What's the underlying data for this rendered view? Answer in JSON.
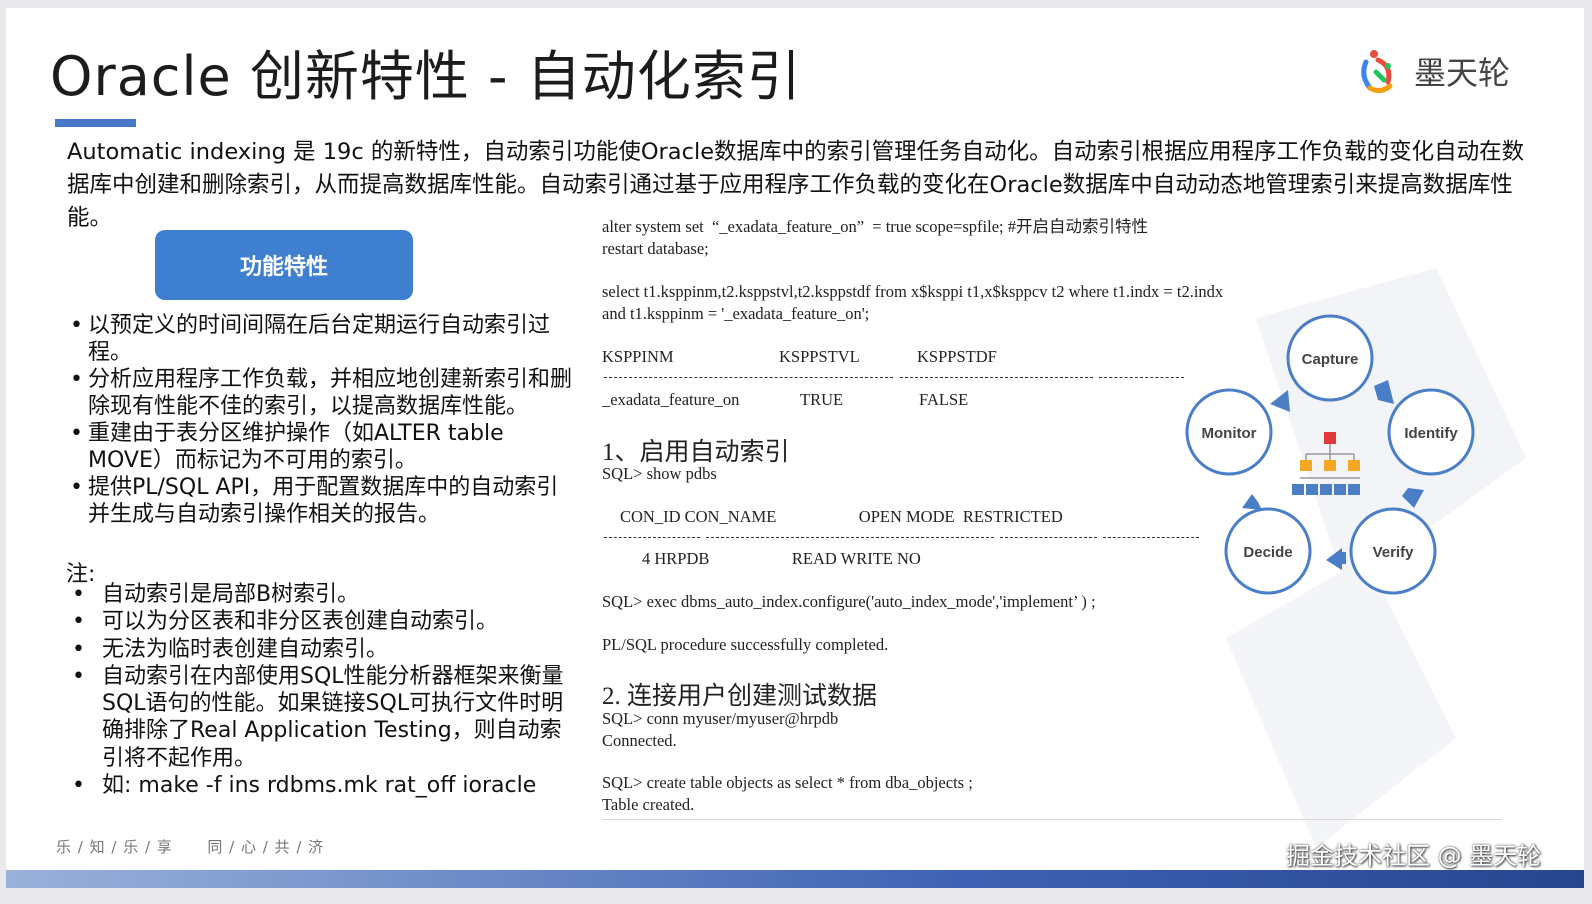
{
  "title": "Oracle 创新特性 - 自动化索引",
  "logo": {
    "text": "墨天轮",
    "colors": [
      "#e94b3c",
      "#3b82f6",
      "#22c55e",
      "#f59e0b"
    ]
  },
  "intro_text": "Automatic indexing 是 19c 的新特性，自动索引功能使Oracle数据库中的索引管理任务自动化。自动索引根据应用程序工作负载的变化自动在数据库中创建和删除索引，从而提高数据库性能。自动索引通过基于应用程序工作负载的变化在Oracle数据库中自动动态地管理索引来提高数据库性能。",
  "feature_label": "功能特性",
  "features": [
    "以预定义的时间间隔在后台定期运行自动索引过程。",
    "分析应用程序工作负载，并相应地创建新索引和删除现有性能不佳的索引，以提高数据库性能。",
    "重建由于表分区维护操作（如ALTER table MOVE）而标记为不可用的索引。",
    "提供PL/SQL API，用于配置数据库中的自动索引并生成与自动索引操作相关的报告。"
  ],
  "note_title": "注:",
  "notes": [
    "自动索引是局部B树索引。",
    "可以为分区表和非分区表创建自动索引。",
    "无法为临时表创建自动索引。",
    "自动索引在内部使用SQL性能分析器框架来衡量SQL语句的性能。如果链接SQL可执行文件时明确排除了Real Application Testing，则自动索引将不起作用。",
    "如: make -f ins rdbms.mk rat_off ioracle"
  ],
  "code": {
    "alter_line": "alter system set  “_exadata_feature_on”  = true scope=spfile; #开启自动索引特性",
    "restart_line": "restart database;",
    "select_line1": "select t1.ksppinm,t2.ksppstvl,t2.ksppstdf from x$ksppi t1,x$ksppcv t2 where t1.indx = t2.indx",
    "select_line2": "and t1.ksppinm = '_exadata_feature_on';",
    "col1": "KSPPINM",
    "col2": "KSPPSTVL",
    "col3": "KSPPSTDF",
    "val1": "_exadata_feature_on",
    "val2": "TRUE",
    "val3": "FALSE",
    "heading1": "1、启用自动索引",
    "show_pdbs": "SQL> show pdbs",
    "pdb_header": "CON_ID CON_NAME                    OPEN MODE  RESTRICTED",
    "pdb_row": "4 HRPDB                    READ WRITE NO",
    "exec_line": "SQL> exec dbms_auto_index.configure('auto_index_mode','implement’ ) ;",
    "plsql_line": "PL/SQL procedure successfully completed.",
    "heading2": "2. 连接用户创建测试数据",
    "conn_line": "SQL> conn myuser/myuser@hrpdb",
    "connected_line": "Connected.",
    "create_line": "SQL> create table objects as select * from dba_objects ;",
    "created_line": "Table created."
  },
  "cycle": {
    "capture": "Capture",
    "identify": "Identify",
    "verify": "Verify",
    "decide": "Decide",
    "monitor": "Monitor"
  },
  "footer_left": "乐 / 知 / 乐 / 享      同 / 心 / 共 / 济",
  "footer_right": "掘金技术社区 @ 墨天轮"
}
